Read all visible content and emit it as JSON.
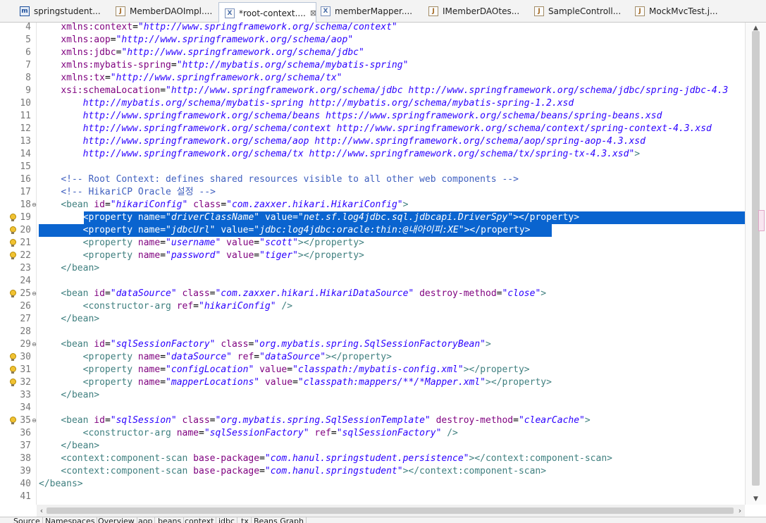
{
  "tabs": [
    {
      "label": "springstudent...",
      "icon": "maven-pom-icon",
      "active": false
    },
    {
      "label": "MemberDAOImpl....",
      "icon": "java-file-icon",
      "active": false
    },
    {
      "label": "*root-context....",
      "icon": "xml-file-icon",
      "active": true,
      "close": "⊠"
    },
    {
      "label": "memberMapper....",
      "icon": "xml-file-icon",
      "active": false
    },
    {
      "label": "IMemberDAOtes...",
      "icon": "java-file-icon",
      "active": false
    },
    {
      "label": "SampleControll...",
      "icon": "java-file-icon",
      "active": false
    },
    {
      "label": "MockMvcTest.j...",
      "icon": "java-file-icon",
      "active": false
    }
  ],
  "editor": {
    "lines": [
      {
        "n": "4",
        "tokens": [
          [
            "txt",
            "    "
          ],
          [
            "attr",
            "xmlns:context"
          ],
          [
            "txt",
            "="
          ],
          [
            "val",
            "\"http://www.springframework.org/schema/context\""
          ]
        ]
      },
      {
        "n": "5",
        "tokens": [
          [
            "txt",
            "    "
          ],
          [
            "attr",
            "xmlns:aop"
          ],
          [
            "txt",
            "="
          ],
          [
            "val",
            "\"http://www.springframework.org/schema/aop\""
          ]
        ]
      },
      {
        "n": "6",
        "tokens": [
          [
            "txt",
            "    "
          ],
          [
            "attr",
            "xmlns:jdbc"
          ],
          [
            "txt",
            "="
          ],
          [
            "val",
            "\"http://www.springframework.org/schema/jdbc\""
          ]
        ]
      },
      {
        "n": "7",
        "tokens": [
          [
            "txt",
            "    "
          ],
          [
            "attr",
            "xmlns:mybatis-spring"
          ],
          [
            "txt",
            "="
          ],
          [
            "val",
            "\"http://mybatis.org/schema/mybatis-spring\""
          ]
        ]
      },
      {
        "n": "8",
        "tokens": [
          [
            "txt",
            "    "
          ],
          [
            "attr",
            "xmlns:tx"
          ],
          [
            "txt",
            "="
          ],
          [
            "val",
            "\"http://www.springframework.org/schema/tx\""
          ]
        ]
      },
      {
        "n": "9",
        "tokens": [
          [
            "txt",
            "    "
          ],
          [
            "attr",
            "xsi:schemaLocation"
          ],
          [
            "txt",
            "="
          ],
          [
            "val",
            "\"http://www.springframework.org/schema/jdbc http://www.springframework.org/schema/jdbc/spring-jdbc-4.3"
          ]
        ]
      },
      {
        "n": "10",
        "tokens": [
          [
            "val",
            "        http://mybatis.org/schema/mybatis-spring http://mybatis.org/schema/mybatis-spring-1.2.xsd"
          ]
        ]
      },
      {
        "n": "11",
        "tokens": [
          [
            "val",
            "        http://www.springframework.org/schema/beans https://www.springframework.org/schema/beans/spring-beans.xsd"
          ]
        ]
      },
      {
        "n": "12",
        "tokens": [
          [
            "val",
            "        http://www.springframework.org/schema/context http://www.springframework.org/schema/context/spring-context-4.3.xsd"
          ]
        ]
      },
      {
        "n": "13",
        "tokens": [
          [
            "val",
            "        http://www.springframework.org/schema/aop http://www.springframework.org/schema/aop/spring-aop-4.3.xsd"
          ]
        ]
      },
      {
        "n": "14",
        "tokens": [
          [
            "val",
            "        http://www.springframework.org/schema/tx http://www.springframework.org/schema/tx/spring-tx-4.3.xsd\""
          ],
          [
            "tag",
            ">"
          ]
        ]
      },
      {
        "n": "15",
        "tokens": []
      },
      {
        "n": "16",
        "tokens": [
          [
            "txt",
            "    "
          ],
          [
            "cmt",
            "<!-- Root Context: defines shared resources visible to all other web components -->"
          ]
        ]
      },
      {
        "n": "17",
        "tokens": [
          [
            "txt",
            "    "
          ],
          [
            "cmt",
            "<!-- HikariCP Oracle 설정 -->"
          ]
        ]
      },
      {
        "n": "18",
        "fold": "⊖",
        "tokens": [
          [
            "txt",
            "    "
          ],
          [
            "tag",
            "<bean "
          ],
          [
            "attr",
            "id"
          ],
          [
            "txt",
            "="
          ],
          [
            "val",
            "\"hikariConfig\""
          ],
          [
            "txt",
            " "
          ],
          [
            "attr",
            "class"
          ],
          [
            "txt",
            "="
          ],
          [
            "val",
            "\"com.zaxxer.hikari.HikariConfig\""
          ],
          [
            "tag",
            ">"
          ]
        ]
      },
      {
        "n": "19",
        "marker": "lightbulb",
        "selected": "partial",
        "tokens": [
          [
            "txt",
            "        "
          ],
          [
            "tag",
            "<property "
          ],
          [
            "attr",
            "name"
          ],
          [
            "txt",
            "="
          ],
          [
            "val",
            "\"driverClassName\""
          ],
          [
            "txt",
            " "
          ],
          [
            "attr",
            "value"
          ],
          [
            "txt",
            "="
          ],
          [
            "val",
            "\"net.sf.log4jdbc.sql.jdbcapi.DriverSpy\""
          ],
          [
            "tag",
            "></property>"
          ]
        ]
      },
      {
        "n": "20",
        "marker": "lightbulb",
        "selected": "line",
        "tokens": [
          [
            "txt",
            "        "
          ],
          [
            "tag",
            "<property "
          ],
          [
            "attr",
            "name"
          ],
          [
            "txt",
            "="
          ],
          [
            "val",
            "\"jdbcUrl\""
          ],
          [
            "txt",
            " "
          ],
          [
            "attr",
            "value"
          ],
          [
            "txt",
            "="
          ],
          [
            "val",
            "\"jdbc:log4jdbc:oracle:thin:@내아이피:XE\""
          ],
          [
            "tag",
            "></property>"
          ]
        ]
      },
      {
        "n": "21",
        "marker": "lightbulb",
        "tokens": [
          [
            "txt",
            "        "
          ],
          [
            "tag",
            "<property "
          ],
          [
            "attr",
            "name"
          ],
          [
            "txt",
            "="
          ],
          [
            "val",
            "\"username\""
          ],
          [
            "txt",
            " "
          ],
          [
            "attr",
            "value"
          ],
          [
            "txt",
            "="
          ],
          [
            "val",
            "\"scott\""
          ],
          [
            "tag",
            "></property>"
          ]
        ]
      },
      {
        "n": "22",
        "marker": "lightbulb",
        "tokens": [
          [
            "txt",
            "        "
          ],
          [
            "tag",
            "<property "
          ],
          [
            "attr",
            "name"
          ],
          [
            "txt",
            "="
          ],
          [
            "val",
            "\"password\""
          ],
          [
            "txt",
            " "
          ],
          [
            "attr",
            "value"
          ],
          [
            "txt",
            "="
          ],
          [
            "val",
            "\"tiger\""
          ],
          [
            "tag",
            "></property>"
          ]
        ]
      },
      {
        "n": "23",
        "tokens": [
          [
            "txt",
            "    "
          ],
          [
            "tag",
            "</bean>"
          ]
        ]
      },
      {
        "n": "24",
        "tokens": []
      },
      {
        "n": "25",
        "fold": "⊖",
        "marker": "lightbulb",
        "tokens": [
          [
            "txt",
            "    "
          ],
          [
            "tag",
            "<bean "
          ],
          [
            "attr",
            "id"
          ],
          [
            "txt",
            "="
          ],
          [
            "val",
            "\"dataSource\""
          ],
          [
            "txt",
            " "
          ],
          [
            "attr",
            "class"
          ],
          [
            "txt",
            "="
          ],
          [
            "val",
            "\"com.zaxxer.hikari.HikariDataSource\""
          ],
          [
            "txt",
            " "
          ],
          [
            "attr",
            "destroy-method"
          ],
          [
            "txt",
            "="
          ],
          [
            "val",
            "\"close\""
          ],
          [
            "tag",
            ">"
          ]
        ]
      },
      {
        "n": "26",
        "tokens": [
          [
            "txt",
            "        "
          ],
          [
            "tag",
            "<constructor-arg "
          ],
          [
            "attr",
            "ref"
          ],
          [
            "txt",
            "="
          ],
          [
            "val",
            "\"hikariConfig\""
          ],
          [
            "txt",
            " "
          ],
          [
            "tag",
            "/>"
          ]
        ]
      },
      {
        "n": "27",
        "tokens": [
          [
            "txt",
            "    "
          ],
          [
            "tag",
            "</bean>"
          ]
        ]
      },
      {
        "n": "28",
        "tokens": []
      },
      {
        "n": "29",
        "fold": "⊖",
        "tokens": [
          [
            "txt",
            "    "
          ],
          [
            "tag",
            "<bean "
          ],
          [
            "attr",
            "id"
          ],
          [
            "txt",
            "="
          ],
          [
            "val",
            "\"sqlSessionFactory\""
          ],
          [
            "txt",
            " "
          ],
          [
            "attr",
            "class"
          ],
          [
            "txt",
            "="
          ],
          [
            "val",
            "\"org.mybatis.spring.SqlSessionFactoryBean\""
          ],
          [
            "tag",
            ">"
          ]
        ]
      },
      {
        "n": "30",
        "marker": "lightbulb",
        "tokens": [
          [
            "txt",
            "        "
          ],
          [
            "tag",
            "<property "
          ],
          [
            "attr",
            "name"
          ],
          [
            "txt",
            "="
          ],
          [
            "val",
            "\"dataSource\""
          ],
          [
            "txt",
            " "
          ],
          [
            "attr",
            "ref"
          ],
          [
            "txt",
            "="
          ],
          [
            "val",
            "\"dataSource\""
          ],
          [
            "tag",
            "></property>"
          ]
        ]
      },
      {
        "n": "31",
        "marker": "lightbulb",
        "tokens": [
          [
            "txt",
            "        "
          ],
          [
            "tag",
            "<property "
          ],
          [
            "attr",
            "name"
          ],
          [
            "txt",
            "="
          ],
          [
            "val",
            "\"configLocation\""
          ],
          [
            "txt",
            " "
          ],
          [
            "attr",
            "value"
          ],
          [
            "txt",
            "="
          ],
          [
            "val",
            "\"classpath:/mybatis-config.xml\""
          ],
          [
            "tag",
            "></property>"
          ]
        ]
      },
      {
        "n": "32",
        "marker": "lightbulb",
        "tokens": [
          [
            "txt",
            "        "
          ],
          [
            "tag",
            "<property "
          ],
          [
            "attr",
            "name"
          ],
          [
            "txt",
            "="
          ],
          [
            "val",
            "\"mapperLocations\""
          ],
          [
            "txt",
            " "
          ],
          [
            "attr",
            "value"
          ],
          [
            "txt",
            "="
          ],
          [
            "val",
            "\"classpath:mappers/**/*Mapper.xml\""
          ],
          [
            "tag",
            "></property>"
          ]
        ]
      },
      {
        "n": "33",
        "tokens": [
          [
            "txt",
            "    "
          ],
          [
            "tag",
            "</bean>"
          ]
        ]
      },
      {
        "n": "34",
        "tokens": []
      },
      {
        "n": "35",
        "fold": "⊖",
        "marker": "lightbulb",
        "tokens": [
          [
            "txt",
            "    "
          ],
          [
            "tag",
            "<bean "
          ],
          [
            "attr",
            "id"
          ],
          [
            "txt",
            "="
          ],
          [
            "val",
            "\"sqlSession\""
          ],
          [
            "txt",
            " "
          ],
          [
            "attr",
            "class"
          ],
          [
            "txt",
            "="
          ],
          [
            "val",
            "\"org.mybatis.spring.SqlSessionTemplate\""
          ],
          [
            "txt",
            " "
          ],
          [
            "attr",
            "destroy-method"
          ],
          [
            "txt",
            "="
          ],
          [
            "val",
            "\"clearCache\""
          ],
          [
            "tag",
            ">"
          ]
        ]
      },
      {
        "n": "36",
        "tokens": [
          [
            "txt",
            "        "
          ],
          [
            "tag",
            "<constructor-arg "
          ],
          [
            "attr",
            "name"
          ],
          [
            "txt",
            "="
          ],
          [
            "val",
            "\"sqlSessionFactory\""
          ],
          [
            "txt",
            " "
          ],
          [
            "attr",
            "ref"
          ],
          [
            "txt",
            "="
          ],
          [
            "val",
            "\"sqlSessionFactory\""
          ],
          [
            "txt",
            " "
          ],
          [
            "tag",
            "/>"
          ]
        ]
      },
      {
        "n": "37",
        "tokens": [
          [
            "txt",
            "    "
          ],
          [
            "tag",
            "</bean>"
          ]
        ]
      },
      {
        "n": "38",
        "tokens": [
          [
            "txt",
            "    "
          ],
          [
            "tag",
            "<context:component-scan "
          ],
          [
            "attr",
            "base-package"
          ],
          [
            "txt",
            "="
          ],
          [
            "val",
            "\"com.hanul.springstudent.persistence\""
          ],
          [
            "tag",
            "></context:component-scan>"
          ]
        ]
      },
      {
        "n": "39",
        "tokens": [
          [
            "txt",
            "    "
          ],
          [
            "tag",
            "<context:component-scan "
          ],
          [
            "attr",
            "base-package"
          ],
          [
            "txt",
            "="
          ],
          [
            "val",
            "\"com.hanul.springstudent\""
          ],
          [
            "tag",
            "></context:component-scan>"
          ]
        ]
      },
      {
        "n": "40",
        "tokens": [
          [
            "tag",
            "</beans>"
          ]
        ]
      },
      {
        "n": "41",
        "tokens": []
      }
    ]
  },
  "bottom_tabs": [
    "Source",
    "Namespaces",
    "Overview",
    "aop",
    "beans",
    "context",
    "jdbc",
    "tx",
    "Beans Graph"
  ],
  "colors": {
    "tag": "#3f7f7f",
    "attr": "#7f007f",
    "value": "#2a00ff",
    "comment": "#3f5fbf",
    "selection": "#0a64cf"
  }
}
